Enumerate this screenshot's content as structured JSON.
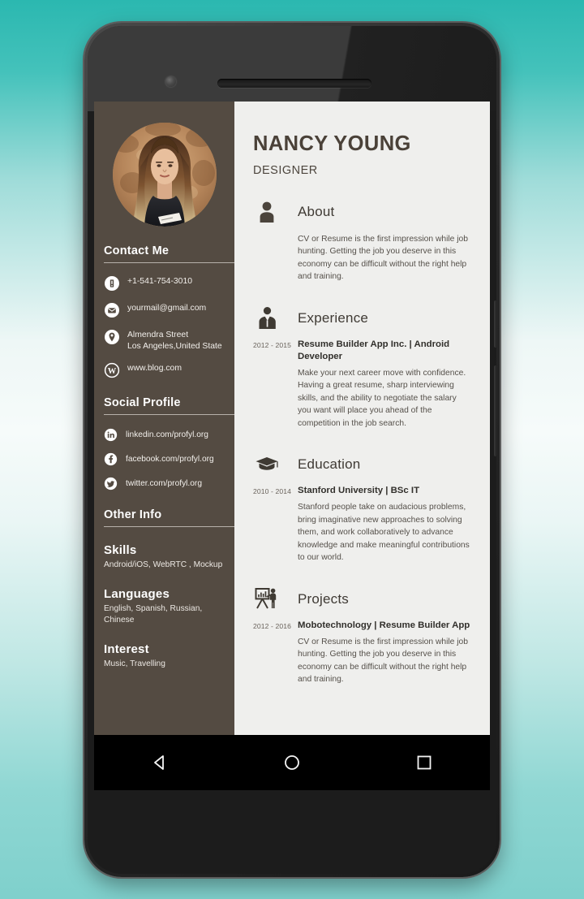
{
  "device": {
    "nav": {
      "back_label": "Back",
      "home_label": "Home",
      "recents_label": "Recent apps"
    }
  },
  "sidebar": {
    "avatar_alt": "Profile photo of Nancy Young",
    "sections": {
      "contact": {
        "heading": "Contact Me",
        "items": [
          {
            "icon": "phone-icon",
            "text": "+1-541-754-3010"
          },
          {
            "icon": "email-icon",
            "text": "yourmail@gmail.com"
          },
          {
            "icon": "location-icon",
            "text": "Almendra Street\nLos Angeles,United State"
          },
          {
            "icon": "website-icon",
            "text": "www.blog.com"
          }
        ]
      },
      "social": {
        "heading": "Social Profile",
        "items": [
          {
            "icon": "linkedin-icon",
            "text": "linkedin.com/profyl.org"
          },
          {
            "icon": "facebook-icon",
            "text": "facebook.com/profyl.org"
          },
          {
            "icon": "twitter-icon",
            "text": "twitter.com/profyl.org"
          }
        ]
      },
      "other_info": {
        "heading": "Other Info",
        "items": [
          {
            "title": "Skills",
            "value": "Android/iOS, WebRTC , Mockup"
          },
          {
            "title": "Languages",
            "value": "English, Spanish, Russian, Chinese"
          },
          {
            "title": "Interest",
            "value": "Music, Travelling"
          }
        ]
      }
    }
  },
  "main": {
    "name": "NANCY YOUNG",
    "role": "DESIGNER",
    "sections": [
      {
        "icon": "person-icon",
        "title": "About",
        "paragraph": "CV or Resume is the first impression while job hunting. Getting the job you deserve in this economy can be difficult without the right help and training."
      },
      {
        "icon": "briefcase-person-icon",
        "title": "Experience",
        "entry_date": "2012 - 2015",
        "entry_title": "Resume Builder App Inc. | Android Developer",
        "entry_desc": "Make your next career move with confidence. Having a great resume, sharp interviewing skills, and the ability to negotiate the salary you want will place you ahead of the competition in the job search."
      },
      {
        "icon": "graduation-cap-icon",
        "title": "Education",
        "entry_date": "2010 - 2014",
        "entry_title": "Stanford University | BSc IT",
        "entry_desc": "Stanford people take on audacious problems, bring imaginative new approaches to solving them, and work collaboratively to advance knowledge and make meaningful contributions to our world."
      },
      {
        "icon": "presentation-icon",
        "title": "Projects",
        "entry_date": "2012 - 2016",
        "entry_title": "Mobotechnology | Resume Builder App",
        "entry_desc": "CV or Resume is the first impression while job hunting. Getting the job you deserve in this economy can be difficult without the right help and training."
      }
    ]
  },
  "colors": {
    "sidebar_bg": "#544b42",
    "screen_bg": "#efefed",
    "accent_text": "#4a4138",
    "background_teal": "#2bb8b0"
  }
}
